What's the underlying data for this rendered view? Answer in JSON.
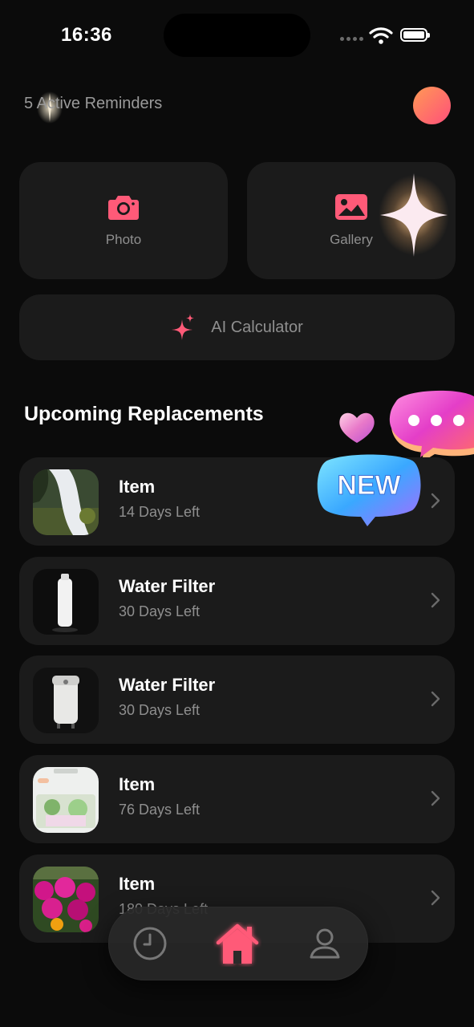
{
  "status_bar": {
    "time": "16:36"
  },
  "header": {
    "reminders_text": "5 Active Reminders"
  },
  "actions": {
    "photo": {
      "label": "Photo",
      "icon": "camera-icon"
    },
    "gallery": {
      "label": "Gallery",
      "icon": "image-icon"
    },
    "ai_calculator": {
      "label": "AI Calculator",
      "icon": "sparkles-icon"
    }
  },
  "section": {
    "title": "Upcoming Replacements"
  },
  "decorations": {
    "new_badge": "NEW"
  },
  "items": [
    {
      "title": "Item",
      "subtitle": "14 Days Left",
      "thumb": "waterfall-photo"
    },
    {
      "title": "Water Filter",
      "subtitle": "30 Days Left",
      "thumb": "filter-cartridge-photo"
    },
    {
      "title": "Water Filter",
      "subtitle": "30 Days Left",
      "thumb": "filter-unit-photo"
    },
    {
      "title": "Item",
      "subtitle": "76 Days Left",
      "thumb": "screenshot-photo"
    },
    {
      "title": "Item",
      "subtitle": "180 Days Left",
      "thumb": "flowers-photo"
    }
  ],
  "tabbar": {
    "tabs": [
      "history-icon",
      "home-icon",
      "profile-icon"
    ],
    "active": "home-icon"
  },
  "colors": {
    "accent": "#ff5a78",
    "card": "#1b1b1b",
    "background": "#0b0b0b",
    "muted_text": "#8f8f8f"
  }
}
